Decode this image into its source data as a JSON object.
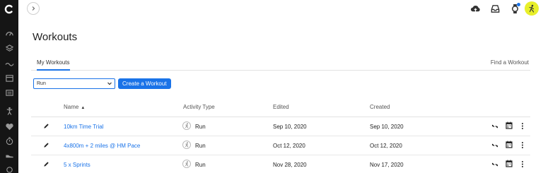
{
  "header": {
    "page_title": "Workouts"
  },
  "tabs": {
    "active_label": "My Workouts",
    "find_link": "Find a Workout"
  },
  "controls": {
    "activity_filter_value": "Run",
    "create_button": "Create a Workout"
  },
  "table": {
    "columns": {
      "name": "Name",
      "activity_type": "Activity Type",
      "edited": "Edited",
      "created": "Created"
    },
    "sort": "ascending",
    "rows": [
      {
        "name": "10km Time Trial",
        "activity": "Run",
        "edited": "Sep 10, 2020",
        "created": "Sep 10, 2020"
      },
      {
        "name": "4x800m + 2 miles @ HM Pace",
        "activity": "Run",
        "edited": "Oct 12, 2020",
        "created": "Oct 12, 2020"
      },
      {
        "name": "5 x Sprints",
        "activity": "Run",
        "edited": "Nov 28, 2020",
        "created": "Nov 17, 2020"
      }
    ]
  },
  "colors": {
    "accent": "#1a73e8",
    "sidebar": "#151515",
    "avatar": "#e8ef2a"
  },
  "icons": {
    "sidebar": [
      "connect-logo-icon",
      "dashboard-icon",
      "layers-icon",
      "activity-wave-icon",
      "calendar-icon",
      "reports-icon",
      "training-icon",
      "health-heart-icon",
      "stopwatch-icon",
      "shoe-icon",
      "more-sidebar-icon"
    ],
    "topbar": [
      "sidebar-toggle-icon",
      "upload-cloud-icon",
      "inbox-icon",
      "device-watch-icon",
      "user-avatar-icon"
    ],
    "row": [
      "edit-pencil-icon",
      "run-activity-icon",
      "share-icon",
      "schedule-calendar-icon",
      "more-options-icon"
    ]
  }
}
